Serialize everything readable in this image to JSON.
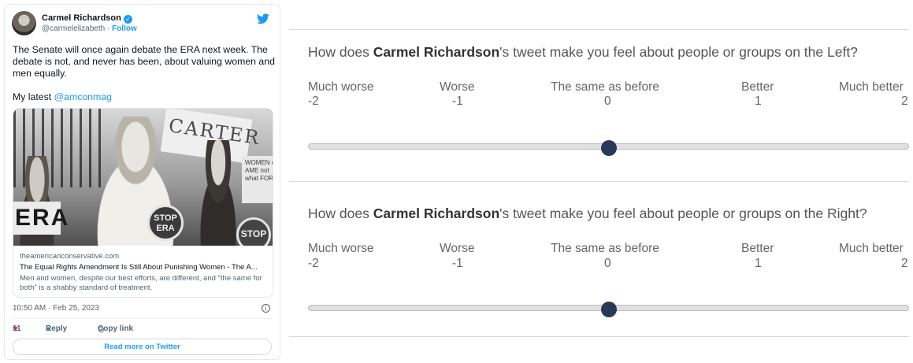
{
  "tweet": {
    "author_name": "Carmel Richardson",
    "handle": "@carmelelizabeth",
    "separator": "·",
    "follow_label": "Follow",
    "text_line1": "The Senate will once again debate the ERA next week. The debate is not, and never has been, about valuing women and men equally.",
    "text_line2_prefix": "My latest ",
    "mention": "@amconmag",
    "link_card": {
      "domain": "theamericanconservative.com",
      "title": "The Equal Rights Amendment Is Still About Punishing Women - The A...",
      "description": "Men and women, despite our best efforts, are different, and \"the same for both\" is a shabby standard of treatment.",
      "photo_sign_top": "CARTER",
      "photo_sign_right": "WOMEN of AME not what FOR",
      "photo_sign_left": "ERA",
      "photo_stop_sign": "STOP ERA",
      "photo_stop_sign_2": "STOP"
    },
    "timestamp": "10:50 AM · Feb 25, 2023",
    "likes": "11",
    "reply_label": "Reply",
    "copy_link_label": "Copy link",
    "read_more_label": "Read more on Twitter"
  },
  "survey": {
    "questions": [
      {
        "prefix": "How does ",
        "subject": "Carmel Richardson",
        "suffix": "'s tweet make you feel about people or groups on the Left?",
        "value": 0
      },
      {
        "prefix": "How does ",
        "subject": "Carmel Richardson",
        "suffix": "'s tweet make you feel about people or groups on the Right?",
        "value": 0
      }
    ],
    "scale": {
      "labels": [
        "Much worse",
        "Worse",
        "The same as before",
        "Better",
        "Much better"
      ],
      "values": [
        "-2",
        "-1",
        "0",
        "1",
        "2"
      ],
      "min": -2,
      "max": 2
    }
  },
  "colors": {
    "twitter_blue": "#1d9bf0",
    "heart_pink": "#f91880",
    "slider_thumb": "#2a3756",
    "slider_track": "#e0e0e0"
  },
  "icons": {
    "bird": "twitter-bird-icon",
    "verified": "verified-badge-icon",
    "info": "info-icon",
    "heart": "heart-icon",
    "reply": "reply-bubble-icon",
    "copy": "link-icon"
  }
}
